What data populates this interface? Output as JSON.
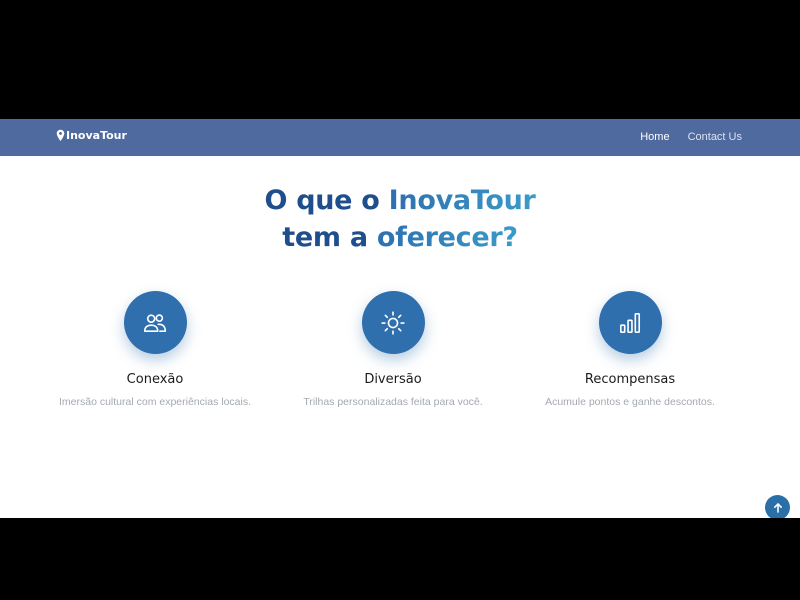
{
  "navbar": {
    "brand": "InovaTour",
    "brand_icon": "location-pin-icon",
    "links": [
      {
        "label": "Home",
        "active": true
      },
      {
        "label": "Contact Us",
        "active": false
      }
    ],
    "background": "#4f6a9f"
  },
  "hero": {
    "line1_dark": "O que o",
    "line1_accent": "InovaTour",
    "line2_dark": "tem a",
    "line2_accent": "oferecer?"
  },
  "features": [
    {
      "icon": "users-icon",
      "title": "Conexão",
      "description": "Imersão cultural com experiências locais."
    },
    {
      "icon": "sun-icon",
      "title": "Diversão",
      "description": "Trilhas personalizadas feita para você."
    },
    {
      "icon": "bar-chart-icon",
      "title": "Recompensas",
      "description": "Acumule pontos e ganhe descontos."
    }
  ],
  "back_to_top_icon": "arrow-up-icon",
  "colors": {
    "accent": "#2f6fad",
    "heading_dark": "#1f4e8c",
    "heading_accent": "#3a9bc8"
  }
}
